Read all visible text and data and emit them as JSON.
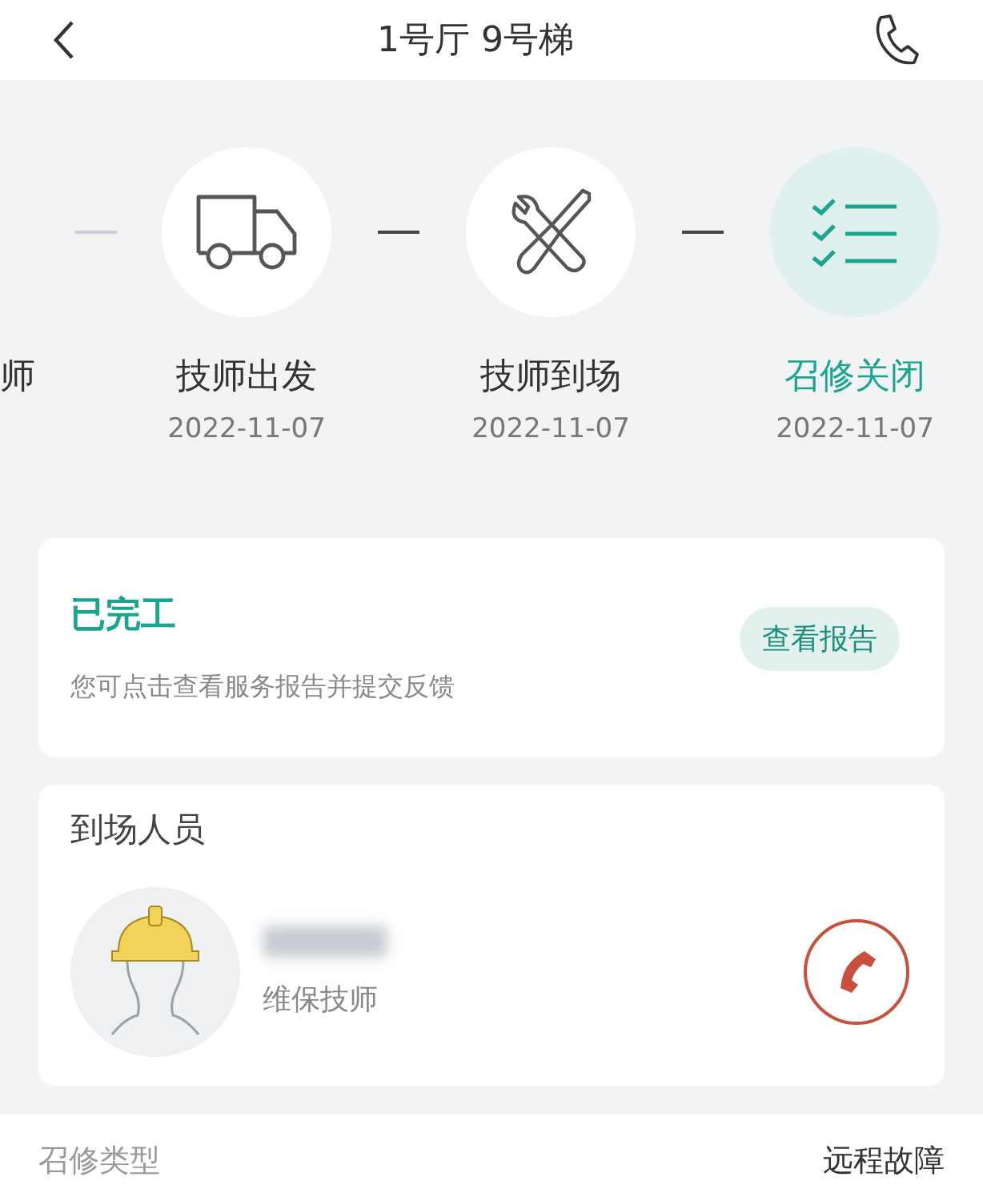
{
  "header": {
    "title": "1号厅 9号梯"
  },
  "steps": [
    {
      "kind": "partial",
      "label": "师",
      "current": false
    },
    {
      "kind": "truck",
      "label": "技师出发",
      "date": "2022-11-07",
      "current": false
    },
    {
      "kind": "tools",
      "label": "技师到场",
      "date": "2022-11-07",
      "current": false
    },
    {
      "kind": "checklist",
      "label": "召修关闭",
      "date": "2022-11-07",
      "current": true
    }
  ],
  "status_card": {
    "status": "已完工",
    "hint": "您可点击查看服务报告并提交反馈",
    "button": "查看报告"
  },
  "staff_card": {
    "title": "到场人员",
    "people": [
      {
        "role": "维保技师"
      }
    ]
  },
  "details": [
    {
      "label": "召修类型",
      "value": "远程故障"
    }
  ]
}
